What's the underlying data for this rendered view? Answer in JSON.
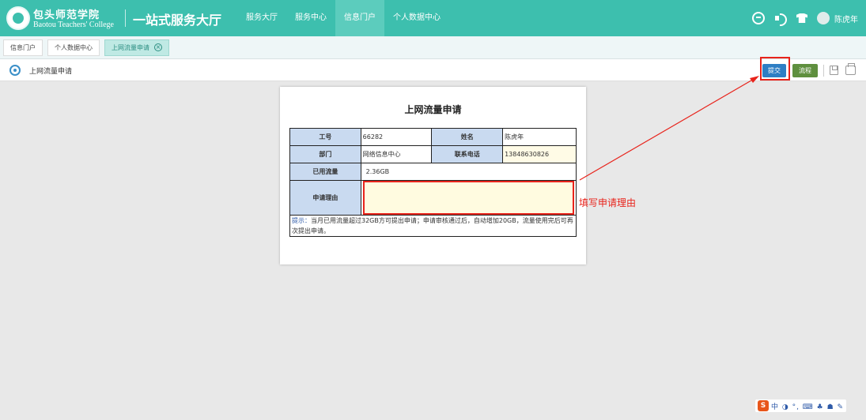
{
  "header": {
    "logo_cn": "包头师范学院",
    "logo_en": "Baotou Teachers' College",
    "app_title": "一站式服务大厅",
    "nav": [
      "服务大厅",
      "服务中心",
      "信息门户",
      "个人数据中心"
    ],
    "active_nav": 2,
    "username": "陈虎年",
    "icons": [
      "chat-icon",
      "sound-icon",
      "shirt-icon",
      "avatar"
    ]
  },
  "tabs": [
    {
      "label": "信息门户",
      "active": false
    },
    {
      "label": "个人数据中心",
      "active": false
    },
    {
      "label": "上网流量申请",
      "active": true
    }
  ],
  "toolbar": {
    "page_title": "上网流量申请",
    "submit_label": "提交",
    "flow_label": "流程"
  },
  "form": {
    "title": "上网流量申请",
    "rows": {
      "staff_id_label": "工号",
      "staff_id": "66282",
      "name_label": "姓名",
      "name": "陈虎年",
      "dept_label": "部门",
      "dept": "网络信息中心",
      "phone_label": "联系电话",
      "phone": "13848630826",
      "used_label": "已用流量",
      "used": "2.36GB",
      "reason_label": "申请理由",
      "reason": ""
    },
    "tip_label": "提示：",
    "tip_text": "当月已用流量超过32GB方可提出申请；申请审核通过后，自动增加20GB，流量使用完后可再次提出申请。"
  },
  "annotation": {
    "text": "填写申请理由",
    "color": "#e8231b"
  },
  "ime": {
    "badge": "S",
    "tray": "中 ◑ °, ⌨ ♣ ☗ ✎"
  },
  "colors": {
    "header_bg": "#3dbfae",
    "submit_btn": "#2e7ec4",
    "flow_btn": "#5f8f3e",
    "label_cell": "#c9daf0",
    "highlight": "#e8231b"
  }
}
